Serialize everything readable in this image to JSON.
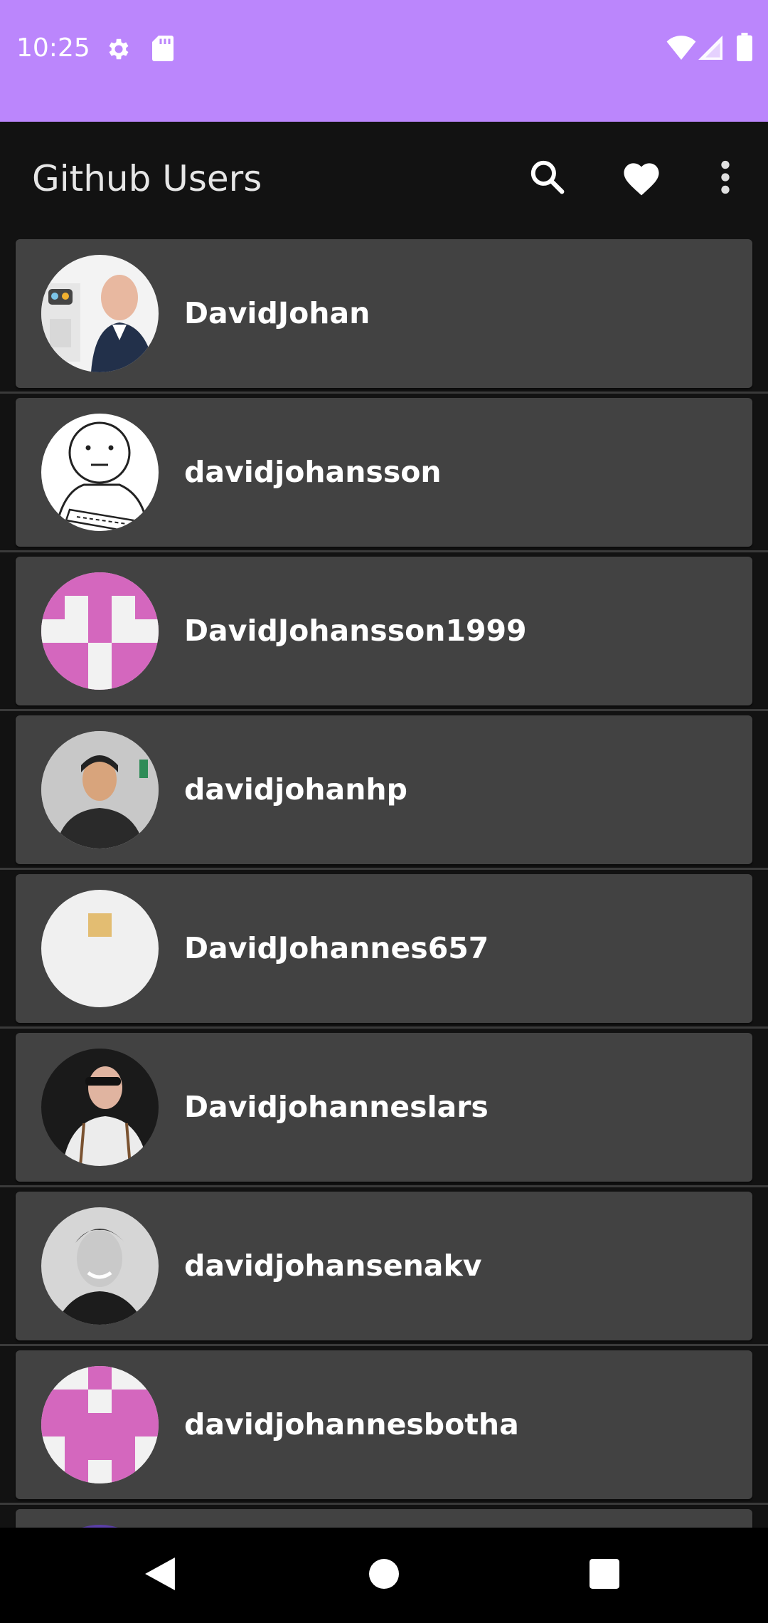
{
  "status_bar": {
    "time": "10:25",
    "background": "#bb86fc",
    "left_icons": [
      "settings-icon",
      "sd-card-icon"
    ],
    "right_icons": [
      "wifi-icon",
      "cell-signal-icon",
      "battery-icon"
    ]
  },
  "app_bar": {
    "title": "Github Users",
    "actions": [
      "search-icon",
      "heart-icon",
      "more-vert-icon"
    ]
  },
  "colors": {
    "background": "#121212",
    "card": "#424242",
    "accent": "#bb86fc",
    "text": "#ffffff"
  },
  "users": [
    {
      "username": "DavidJohan",
      "avatar": "photo"
    },
    {
      "username": "davidjohansson",
      "avatar": "sketch-face"
    },
    {
      "username": "DavidJohansson1999",
      "avatar": "identicon-pink"
    },
    {
      "username": "davidjohanhp",
      "avatar": "photo"
    },
    {
      "username": "DavidJohannes657",
      "avatar": "identicon-yellow"
    },
    {
      "username": "Davidjohanneslars",
      "avatar": "photo"
    },
    {
      "username": "davidjohansenakv",
      "avatar": "photo"
    },
    {
      "username": "davidjohannesbotha",
      "avatar": "identicon-pink"
    },
    {
      "username": "",
      "avatar": "photo"
    }
  ],
  "nav_bar": {
    "buttons": [
      "back-icon",
      "home-icon",
      "recents-icon"
    ]
  }
}
